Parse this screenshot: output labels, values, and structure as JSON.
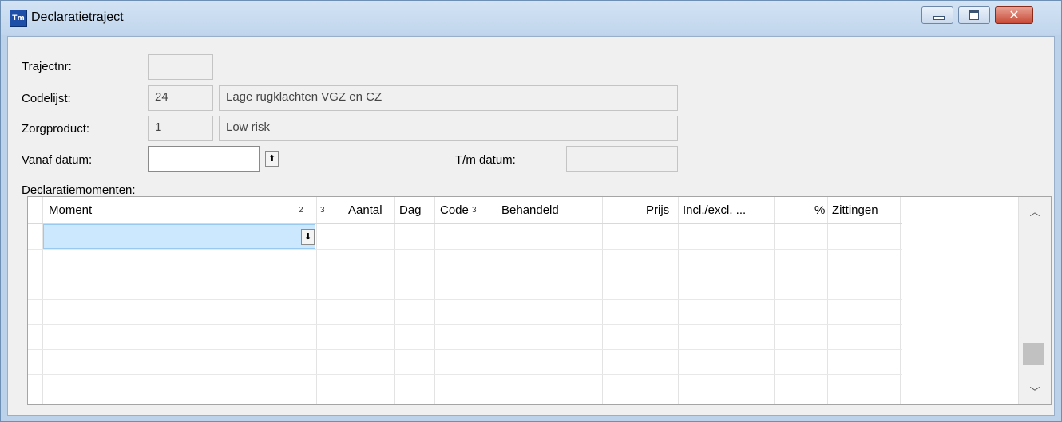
{
  "window": {
    "title": "Declaratietraject",
    "icon_text": "Tm"
  },
  "form": {
    "trajectnr": {
      "label": "Trajectnr:",
      "value": ""
    },
    "codelijst": {
      "label": "Codelijst:",
      "code": "24",
      "description": "Lage rugklachten VGZ en CZ"
    },
    "zorgproduct": {
      "label": "Zorgproduct:",
      "code": "1",
      "description": "Low risk"
    },
    "vanaf": {
      "label": "Vanaf datum:",
      "value": ""
    },
    "tm": {
      "label": "T/m datum:",
      "value": ""
    }
  },
  "grid": {
    "label": "Declaratiemomenten:",
    "columns": [
      {
        "label": "Moment",
        "icon": "2"
      },
      {
        "label": "",
        "icon": "3"
      },
      {
        "label": "Aantal"
      },
      {
        "label": "Dag"
      },
      {
        "label": "Code",
        "icon": "3"
      },
      {
        "label": "Behandeld"
      },
      {
        "label": "Prijs"
      },
      {
        "label": "Incl./excl. ..."
      },
      {
        "label": "%"
      },
      {
        "label": "Zittingen"
      }
    ]
  },
  "icons": {
    "app": "app-icon",
    "minimize": "minimize-icon",
    "maximize": "maximize-icon",
    "close": "close-icon",
    "date_picker": "date-picker-arrow-icon",
    "dropdown": "dropdown-arrow-icon",
    "scroll_up": "chevron-up-icon",
    "scroll_down": "chevron-down-icon"
  },
  "colors": {
    "selected_row": "#cce8ff",
    "close_button": "#c74a36",
    "titlebar": "#c0d5ec"
  }
}
